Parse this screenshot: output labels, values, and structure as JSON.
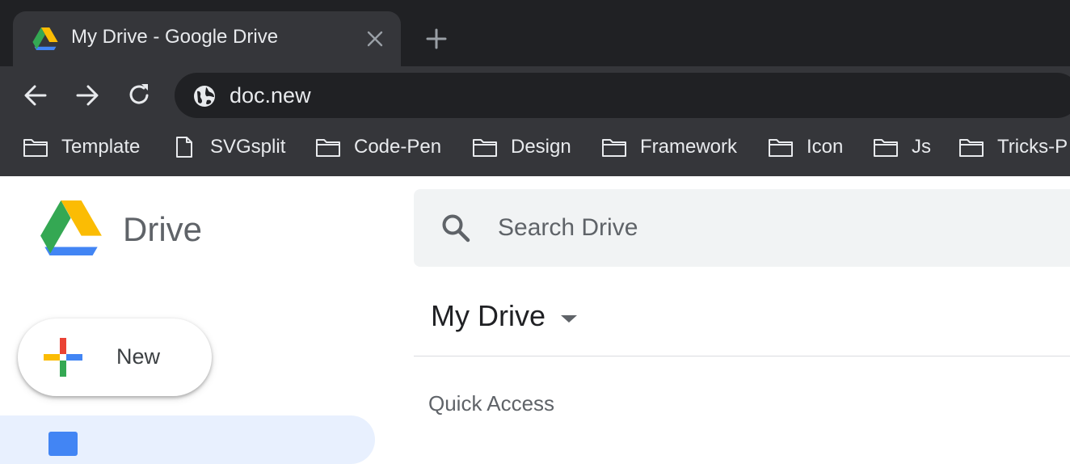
{
  "browser": {
    "tab": {
      "title": "My Drive - Google Drive"
    },
    "omnibox": {
      "url": "doc.new"
    },
    "bookmarks": [
      {
        "label": "Template",
        "icon": "folder-icon"
      },
      {
        "label": "SVGsplit",
        "icon": "page-icon"
      },
      {
        "label": "Code-Pen",
        "icon": "folder-icon"
      },
      {
        "label": "Design",
        "icon": "folder-icon"
      },
      {
        "label": "Framework",
        "icon": "folder-icon"
      },
      {
        "label": "Icon",
        "icon": "folder-icon"
      },
      {
        "label": "Js",
        "icon": "folder-icon"
      },
      {
        "label": "Tricks-P",
        "icon": "folder-icon"
      }
    ]
  },
  "app": {
    "name": "Drive",
    "search": {
      "placeholder": "Search Drive",
      "value": ""
    },
    "new_button": {
      "label": "New"
    },
    "main": {
      "title": "My Drive",
      "section": "Quick Access"
    }
  },
  "colors": {
    "chrome_dark": "#202124",
    "chrome_toolbar": "#35363a",
    "accent_blue": "#4285f4",
    "google_red": "#ea4335",
    "google_yellow": "#fbbc04",
    "google_green": "#34a853"
  }
}
